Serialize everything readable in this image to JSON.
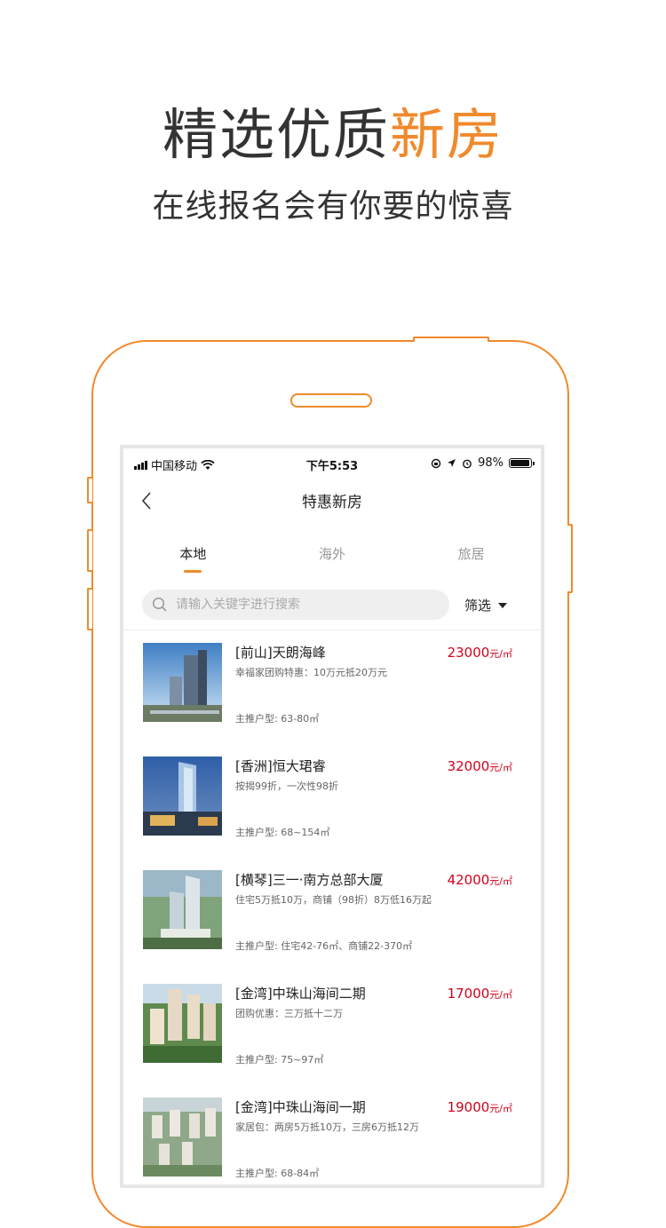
{
  "headline": {
    "main": "精选优质",
    "accent": "新房",
    "sub": "在线报名会有你要的惊喜"
  },
  "colors": {
    "accent": "#f08a2c",
    "price": "#d0021b"
  },
  "status_bar": {
    "carrier": "中国移动",
    "time": "下午5:53",
    "battery": "98%"
  },
  "nav": {
    "title": "特惠新房",
    "back_icon": "chevron-left-icon"
  },
  "tabs": [
    {
      "label": "本地",
      "active": true
    },
    {
      "label": "海外",
      "active": false
    },
    {
      "label": "旅居",
      "active": false
    }
  ],
  "search": {
    "placeholder": "请输入关键字进行搜索",
    "filter_label": "筛选"
  },
  "listings": [
    {
      "name": "[前山]天朗海峰",
      "price": "23000",
      "unit": "元/㎡",
      "promo": "幸福家团购特惠：10万元抵20万元",
      "layout": "主推户型: 63-80㎡"
    },
    {
      "name": "[香洲]恒大珺睿",
      "price": "32000",
      "unit": "元/㎡",
      "promo": "按揭99折，一次性98折",
      "layout": "主推户型: 68~154㎡"
    },
    {
      "name": "[横琴]三一·南方总部大厦",
      "price": "42000",
      "unit": "元/㎡",
      "promo": "住宅5万抵10万，商铺（98折）8万低16万起",
      "layout": "主推户型: 住宅42-76㎡、商铺22-370㎡"
    },
    {
      "name": "[金湾]中珠山海间二期",
      "price": "17000",
      "unit": "元/㎡",
      "promo": "团购优惠：三万抵十二万",
      "layout": "主推户型: 75~97㎡"
    },
    {
      "name": "[金湾]中珠山海间一期",
      "price": "19000",
      "unit": "元/㎡",
      "promo": "家居包：两房5万抵10万，三房6万抵12万",
      "layout": "主推户型: 68-84㎡"
    }
  ]
}
